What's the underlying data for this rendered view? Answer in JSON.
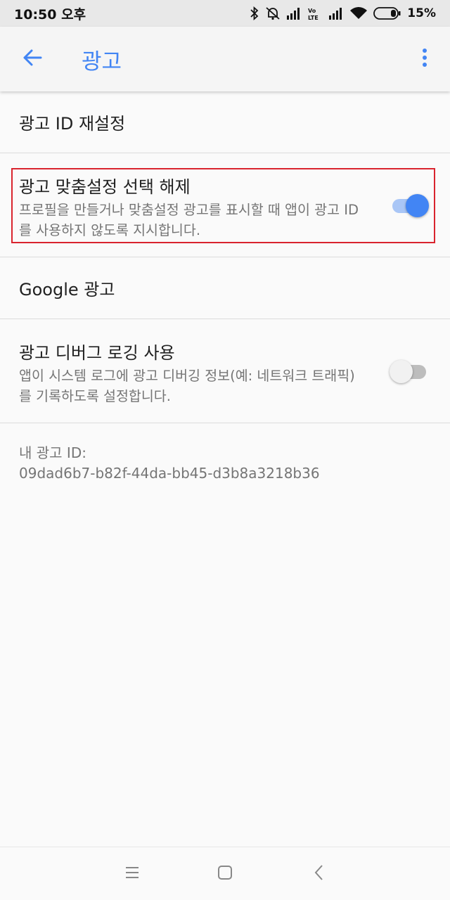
{
  "status_bar": {
    "time": "10:50 오후",
    "battery_percent": "15%",
    "icons": [
      "bluetooth-icon",
      "mute-icon",
      "signal-icon",
      "volte-icon",
      "signal-icon",
      "wifi-icon",
      "battery-icon"
    ]
  },
  "app_bar": {
    "title": "광고",
    "back_icon": "arrow-left-icon",
    "menu_icon": "more-vert-icon"
  },
  "settings": {
    "reset_ad_id": {
      "title": "광고 ID 재설정"
    },
    "opt_out_personalization": {
      "title": "광고 맞춤설정 선택 해제",
      "summary": "프로필을 만들거나 맞춤설정 광고를 표시할 때 앱이 광고 ID를 사용하지 않도록 지시합니다.",
      "enabled": true
    },
    "google_ads": {
      "title": "Google 광고"
    },
    "ad_debug_logging": {
      "title": "광고 디버그 로깅 사용",
      "summary": "앱이 시스템 로그에 광고 디버깅 정보(예: 네트워크 트래픽)를 기록하도록 설정합니다.",
      "enabled": false
    }
  },
  "ad_id": {
    "label": "내 광고 ID:",
    "value": "09dad6b7-b82f-44da-bb45-d3b8a3218b36"
  },
  "colors": {
    "accent": "#4285f4",
    "highlight_border": "#d9242e"
  },
  "nav_bar": {
    "icons": [
      "menu-icon",
      "home-square-icon",
      "back-chevron-icon"
    ]
  }
}
